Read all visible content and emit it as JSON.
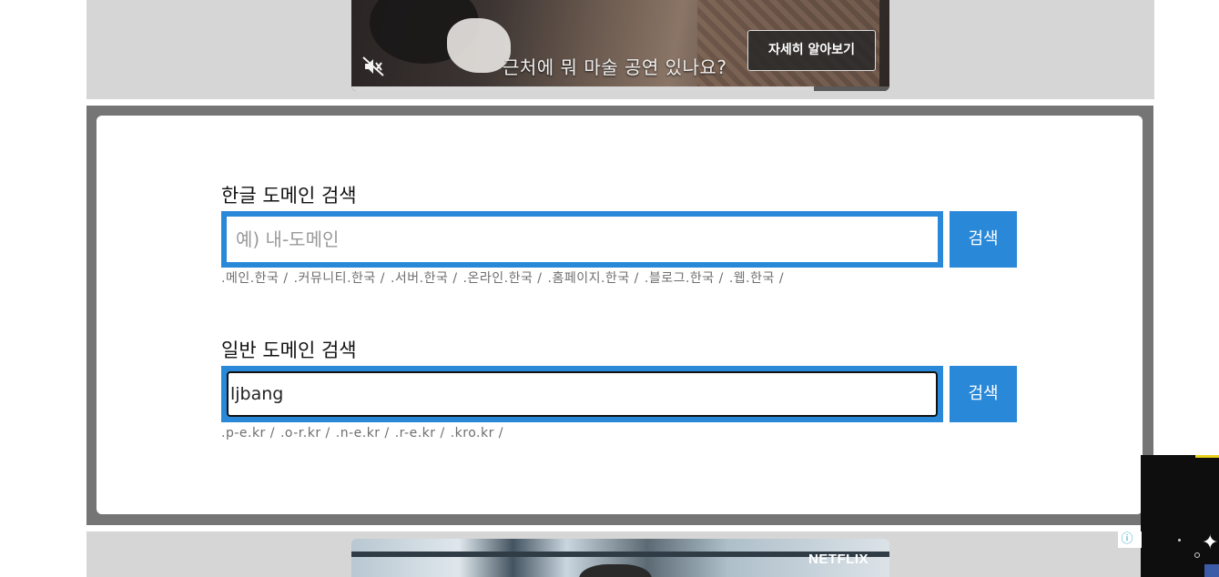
{
  "top_ad": {
    "caption": "근처에 뭐 마술 공연 있나요?",
    "cta_label": "자세히 알아보기",
    "mute_icon": "speaker-muted-icon",
    "progress_fraction": 0.86
  },
  "korean_search": {
    "title": "한글 도메인 검색",
    "placeholder": "예) 내-도메인",
    "value": "",
    "button_label": "검색",
    "tlds": [
      ".메인.한국 /",
      ".커뮤니티.한국 /",
      ".서버.한국 /",
      ".온라인.한국 /",
      ".홈페이지.한국 /",
      ".블로그.한국 /",
      ".웹.한국 /"
    ]
  },
  "general_search": {
    "title": "일반 도메인 검색",
    "value": "ljbang",
    "button_label": "검색",
    "tlds": [
      ".p-e.kr /",
      ".o-r.kr /",
      ".n-e.kr /",
      ".r-e.kr /",
      ".kro.kr /"
    ]
  },
  "bottom_ad": {
    "brand": "NETFLIX"
  },
  "ad_info_icon": "info-icon",
  "colors": {
    "accent_blue": "#2a88d8",
    "section_gray": "#757575",
    "band_gray": "#d6d6d6"
  }
}
